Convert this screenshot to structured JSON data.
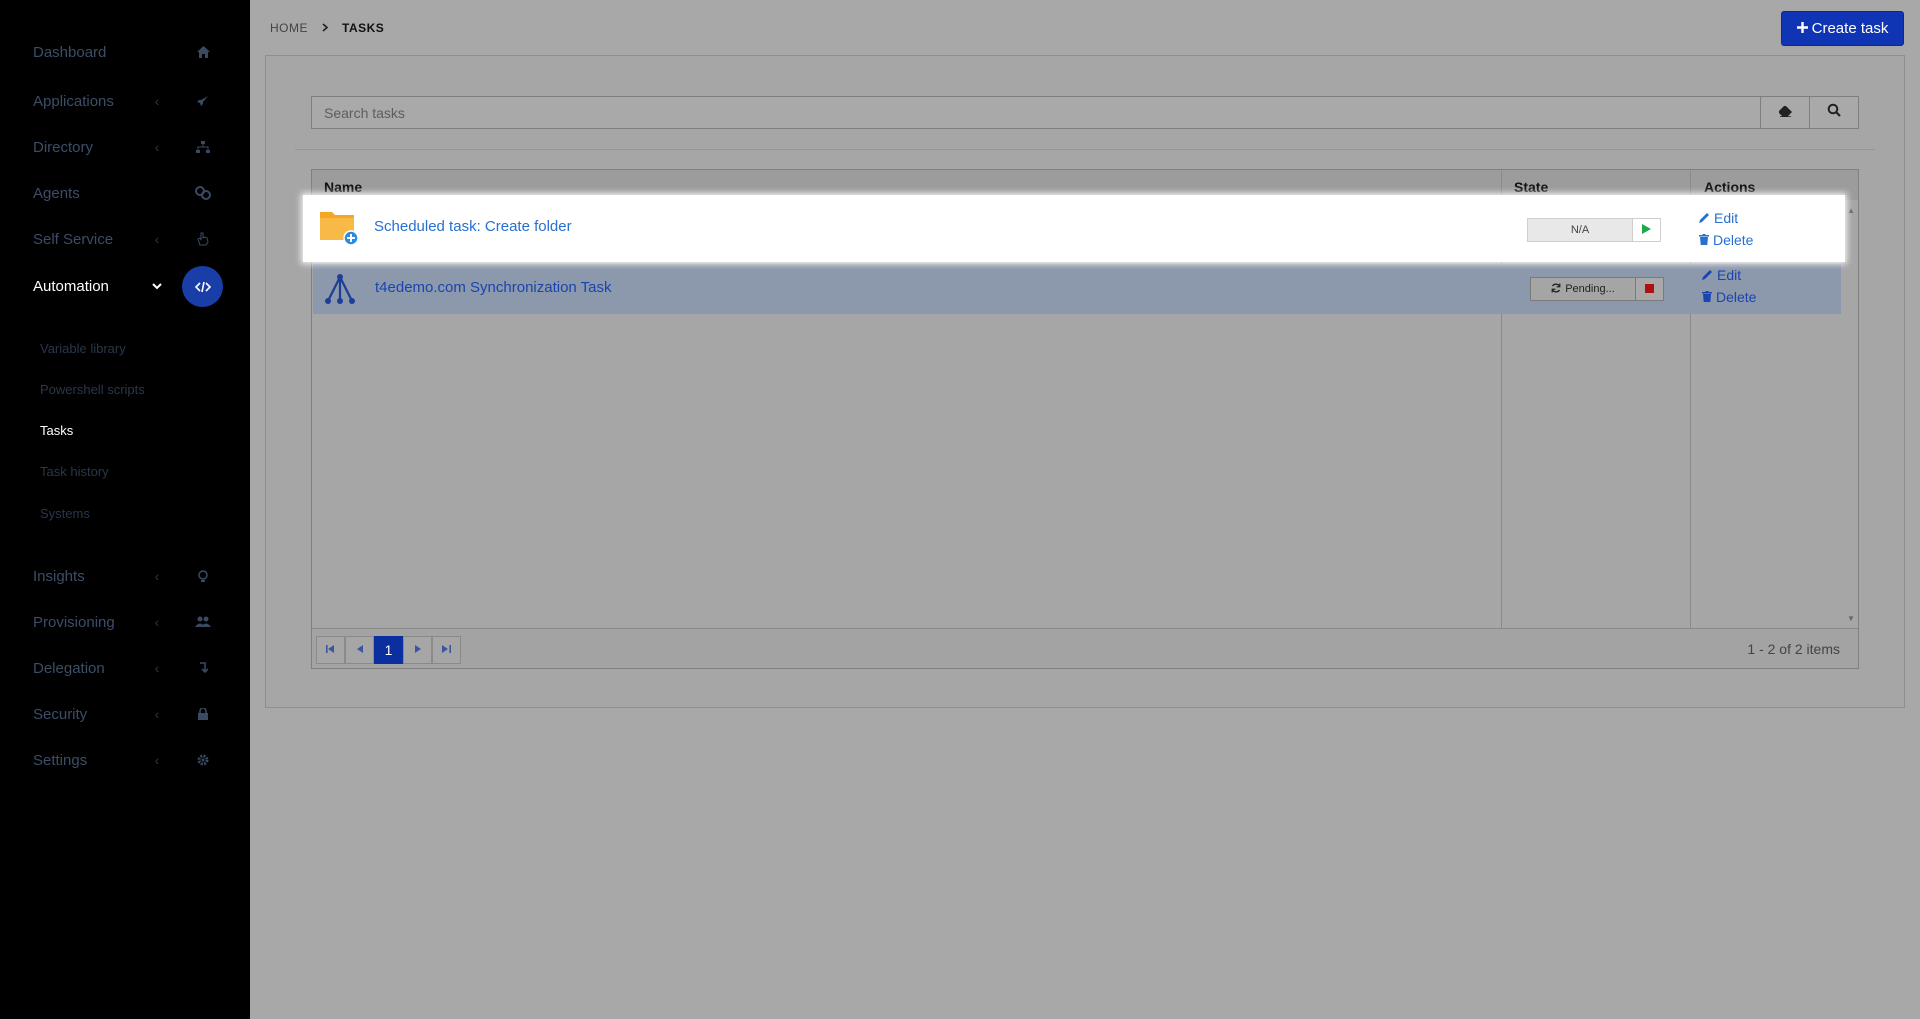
{
  "sidebar": {
    "items": [
      {
        "label": "Dashboard",
        "icon": "home-icon"
      },
      {
        "label": "Applications",
        "icon": "rocket-icon"
      },
      {
        "label": "Directory",
        "icon": "sitemap-icon"
      },
      {
        "label": "Agents",
        "icon": "agents-icon"
      },
      {
        "label": "Self Service",
        "icon": "hand-icon"
      },
      {
        "label": "Automation",
        "icon": "code-icon"
      },
      {
        "label": "Insights",
        "icon": "lightbulb-icon"
      },
      {
        "label": "Provisioning",
        "icon": "users-icon"
      },
      {
        "label": "Delegation",
        "icon": "delegation-icon"
      },
      {
        "label": "Security",
        "icon": "lock-icon"
      },
      {
        "label": "Settings",
        "icon": "gear-icon"
      }
    ],
    "subitems": [
      "Variable library",
      "Powershell scripts",
      "Tasks",
      "Task history",
      "Systems"
    ],
    "active_item": "Automation",
    "active_subitem": "Tasks"
  },
  "header": {
    "breadcrumb_home": "HOME",
    "breadcrumb_current": "TASKS",
    "create_button": "Create task"
  },
  "search": {
    "placeholder": "Search tasks"
  },
  "table": {
    "columns": [
      "Name",
      "State",
      "Actions"
    ],
    "rows": [
      {
        "name": "Scheduled task: Create folder",
        "icon": "folder-plus-icon",
        "state": "N/A",
        "state_action": "play-icon",
        "edit": "Edit",
        "delete": "Delete"
      },
      {
        "name": "t4edemo.com Synchronization Task",
        "icon": "sync-tree-icon",
        "state": "Pending...",
        "state_action": "stop-icon",
        "edit": "Edit",
        "delete": "Delete"
      }
    ]
  },
  "pager": {
    "current_page": "1",
    "info": "1 - 2 of 2 items"
  },
  "colors": {
    "accent": "#0f35b5",
    "link": "#2770d0",
    "play": "#1fa84a",
    "stop": "#b01010",
    "folder": "#f5a623"
  }
}
